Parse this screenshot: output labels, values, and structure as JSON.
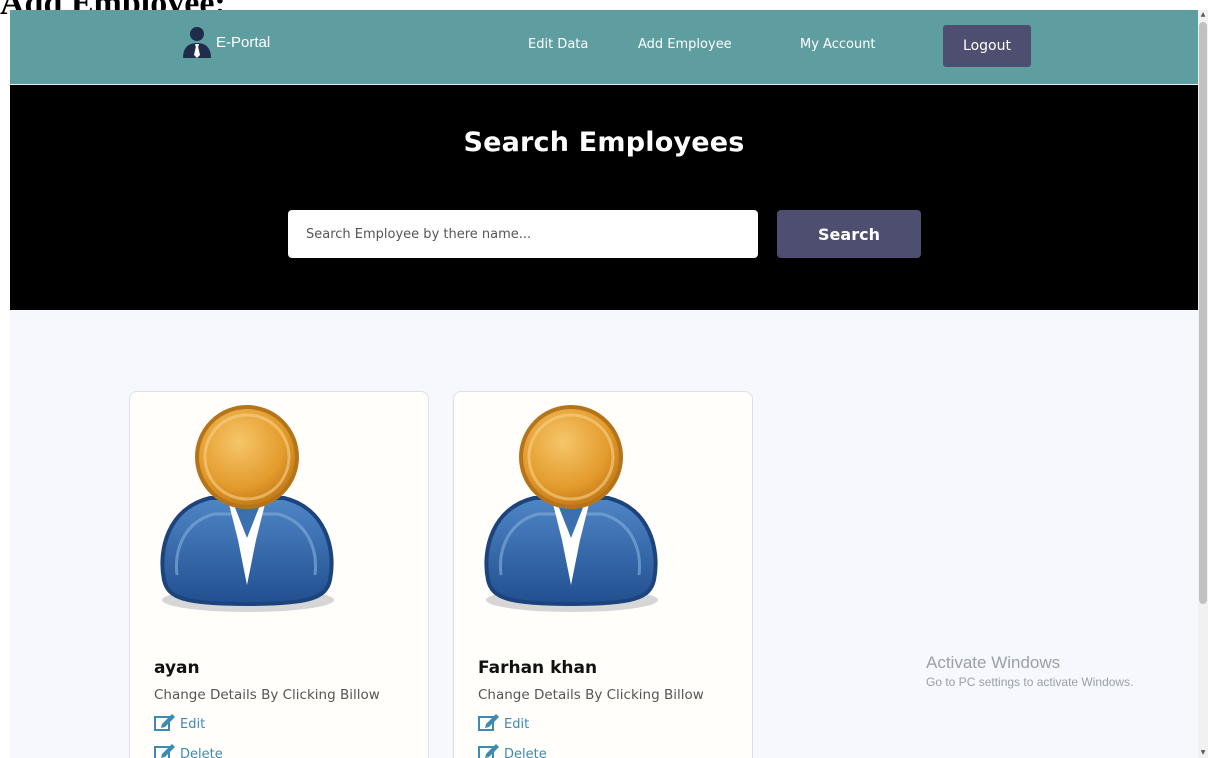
{
  "document": {
    "heading": "Add Employee:"
  },
  "navbar": {
    "brand": "E-Portal",
    "links": [
      "Edit Data",
      "Add Employee",
      "My Account"
    ],
    "logout_label": "Logout",
    "bg_color": "#5f9ea0"
  },
  "hero": {
    "title": "Search Employees",
    "search_placeholder": "Search Employee by there name...",
    "search_button": "Search"
  },
  "employees": [
    {
      "name": "ayan",
      "subtitle": "Change Details By Clicking Billow",
      "edit_label": "Edit",
      "delete_label": "Delete"
    },
    {
      "name": "Farhan khan",
      "subtitle": "Change Details By Clicking Billow",
      "edit_label": "Edit",
      "delete_label": "Delete"
    }
  ],
  "watermark": {
    "title": "Activate Windows",
    "subtitle": "Go to PC settings to activate Windows."
  },
  "icons": [
    "user-tie-icon",
    "user-avatar-icon",
    "edit-icon",
    "delete-icon",
    "scroll-up-icon",
    "scroll-down-icon"
  ],
  "colors": {
    "accent_button": "#4e4e70",
    "link": "#3d8bb0",
    "hero_bg": "#000000"
  }
}
